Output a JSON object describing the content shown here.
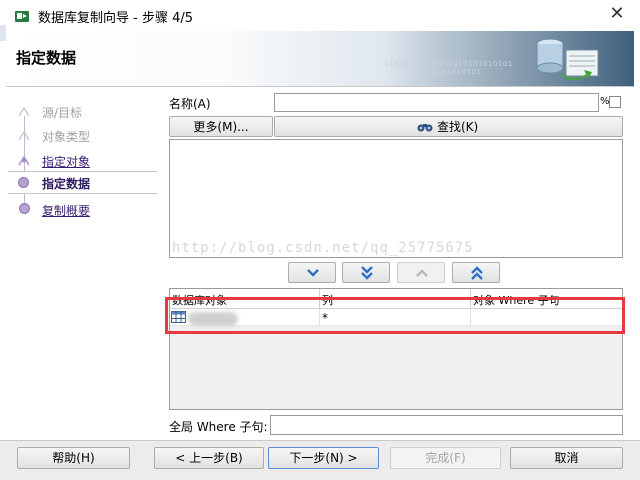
{
  "window": {
    "title": "数据库复制向导 - 步骤 4/5",
    "close_glyph": "✕"
  },
  "header": {
    "title": "指定数据",
    "binary_1": "01010101010101010101010101",
    "binary_2": "010101010101"
  },
  "nav": {
    "items": [
      {
        "label": "源/目标",
        "state": "disabled"
      },
      {
        "label": "对象类型",
        "state": "disabled"
      },
      {
        "label": "指定对象",
        "state": "link"
      },
      {
        "label": "指定数据",
        "state": "current"
      },
      {
        "label": "复制概要",
        "state": "link"
      }
    ]
  },
  "form": {
    "name_label": "名称(A)",
    "name_value": "",
    "percent_sign": "%",
    "more_button": "更多(M)...",
    "find_button": "查找(K)",
    "watermark": "http://blog.csdn.net/qq_25775675"
  },
  "table": {
    "headers": [
      "数据库对象",
      "列",
      "对象 Where 子句"
    ],
    "rows": [
      {
        "object": "",
        "column": "*",
        "where": ""
      }
    ]
  },
  "global_where": {
    "label": "全局 Where 子句:",
    "value": ""
  },
  "footer": {
    "help": "帮助(H)",
    "back": "< 上一步(B)",
    "next": "下一步(N) >",
    "finish": "完成(F)",
    "cancel": "取消"
  },
  "colors": {
    "highlight_border": "#e53a3e",
    "nav_link": "#3a1e73",
    "nav_dot": "#b7a3cf",
    "arrow_icon": "#2f6fc5"
  },
  "icons": [
    "app-icon",
    "close-icon",
    "wizard-graphic-icon",
    "binoculars-icon",
    "move-down-icon",
    "move-all-down-icon",
    "move-up-icon",
    "move-all-up-icon",
    "table-icon"
  ]
}
